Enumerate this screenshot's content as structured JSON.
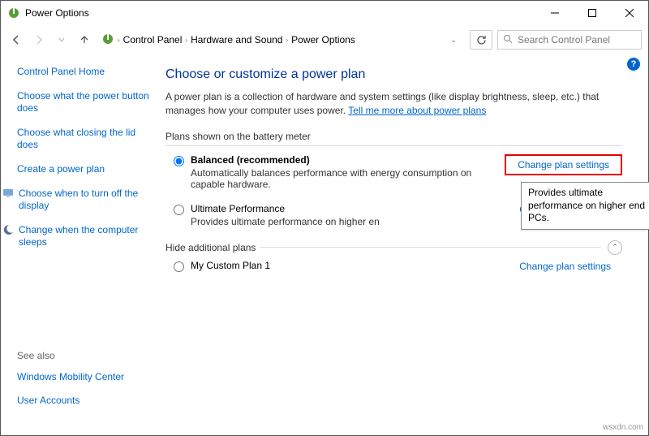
{
  "window": {
    "title": "Power Options"
  },
  "breadcrumb": {
    "items": [
      "Control Panel",
      "Hardware and Sound",
      "Power Options"
    ]
  },
  "search": {
    "placeholder": "Search Control Panel"
  },
  "sidebar": {
    "home": "Control Panel Home",
    "links": [
      "Choose what the power button does",
      "Choose what closing the lid does",
      "Create a power plan",
      "Choose when to turn off the display",
      "Change when the computer sleeps"
    ],
    "seealso_label": "See also",
    "seealso": [
      "Windows Mobility Center",
      "User Accounts"
    ]
  },
  "main": {
    "heading": "Choose or customize a power plan",
    "desc_prefix": "A power plan is a collection of hardware and system settings (like display brightness, sleep, etc.) that manages how your computer uses power. ",
    "desc_link": "Tell me more about power plans",
    "plans_shown_label": "Plans shown on the battery meter",
    "plans": [
      {
        "name": "Balanced (recommended)",
        "desc": "Automatically balances performance with energy consumption on capable hardware.",
        "link": "Change plan settings",
        "selected": true,
        "highlighted": true
      },
      {
        "name": "Ultimate Performance",
        "desc": "Provides ultimate performance on higher en",
        "link": "Change plan settings",
        "selected": false,
        "highlighted": false
      }
    ],
    "hide_label": "Hide additional plans",
    "extra_plans": [
      {
        "name": "My Custom Plan 1",
        "link": "Change plan settings"
      }
    ]
  },
  "tooltip": {
    "text": "Provides ultimate performance on higher end PCs."
  },
  "watermark": "wsxdn.com"
}
